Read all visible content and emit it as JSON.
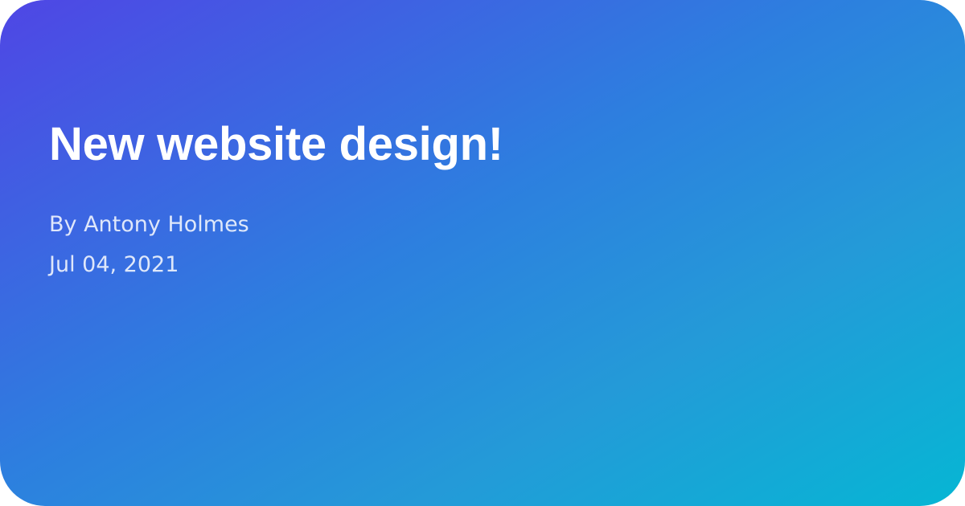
{
  "card": {
    "title": "New website design!",
    "author": "By Antony Holmes",
    "date": "Jul 04, 2021"
  },
  "colors": {
    "gradient_start": "#4f46e5",
    "gradient_end": "#06b6d4",
    "text": "#ffffff"
  }
}
